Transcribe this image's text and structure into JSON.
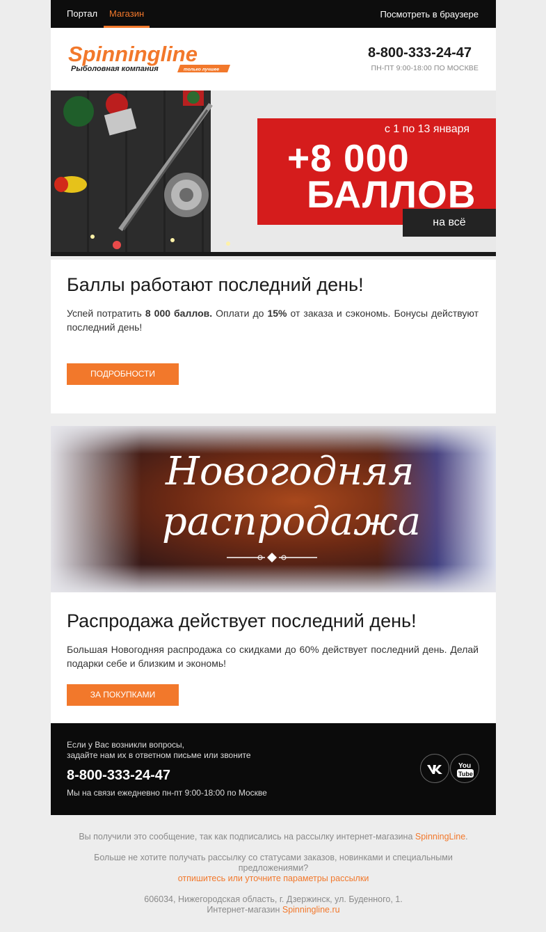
{
  "nav": {
    "portal": "Портал",
    "shop": "Магазин",
    "view_in_browser": "Посмотреть в браузере"
  },
  "header": {
    "logo_text": "Spinningline",
    "logo_subtitle": "Рыболовная компания",
    "logo_tag": "только лучшее",
    "phone": "8-800-333-24-47",
    "hours": "ПН-ПТ 9:00-18:00 ПО МОСКВЕ"
  },
  "banner1": {
    "date": "с 1 по 13 января",
    "amount": "+8 000",
    "word": "БАЛЛОВ",
    "tag": "на всё"
  },
  "block1": {
    "title": "Баллы работают последний день!",
    "text_1": "Успей потратить ",
    "text_bold_1": "8 000 баллов.",
    "text_2": " Оплати до ",
    "text_bold_2": "15%",
    "text_3": " от заказа и сэкономь. Бонусы действуют последний день!",
    "button": "ПОДРОБНОСТИ"
  },
  "banner2": {
    "line1": "Новогодняя",
    "line2": "распродажа"
  },
  "block2": {
    "title": "Распродажа действует последний день!",
    "text": "Большая Новогодняя распродажа со скидками до 60% действует последний день. Делай подарки себе и близким и экономь!",
    "button": "ЗА ПОКУПКАМИ"
  },
  "footer": {
    "question_1": "Если у Вас возникли вопросы,",
    "question_2": "задайте нам их в ответном письме или звоните",
    "phone": "8-800-333-24-47",
    "hours": "Мы на связи ежедневно пн-пт 9:00-18:00 по Москве",
    "social": [
      "vk-icon",
      "youtube-icon"
    ]
  },
  "bottom": {
    "subscribed_prefix": "Вы получили это сообщение, так как подписались на рассылку интернет-магазина ",
    "subscribed_link": "SpinningLine",
    "subscribed_suffix": ".",
    "unsubscribe_text": "Больше не хотите получать рассылку со статусами заказов, новинками и специальными предложениями?",
    "unsubscribe_link": "отпишитесь или уточните параметры рассылки",
    "address": "606034, Нижегородская область, г. Дзержинск, ул. Буденного, 1.",
    "shop_prefix": "Интернет-магазин ",
    "shop_link": "Spinningline.ru"
  },
  "colors": {
    "accent": "#f2782b",
    "dark": "#0d0d0d",
    "banner_red": "#d51c1c"
  }
}
